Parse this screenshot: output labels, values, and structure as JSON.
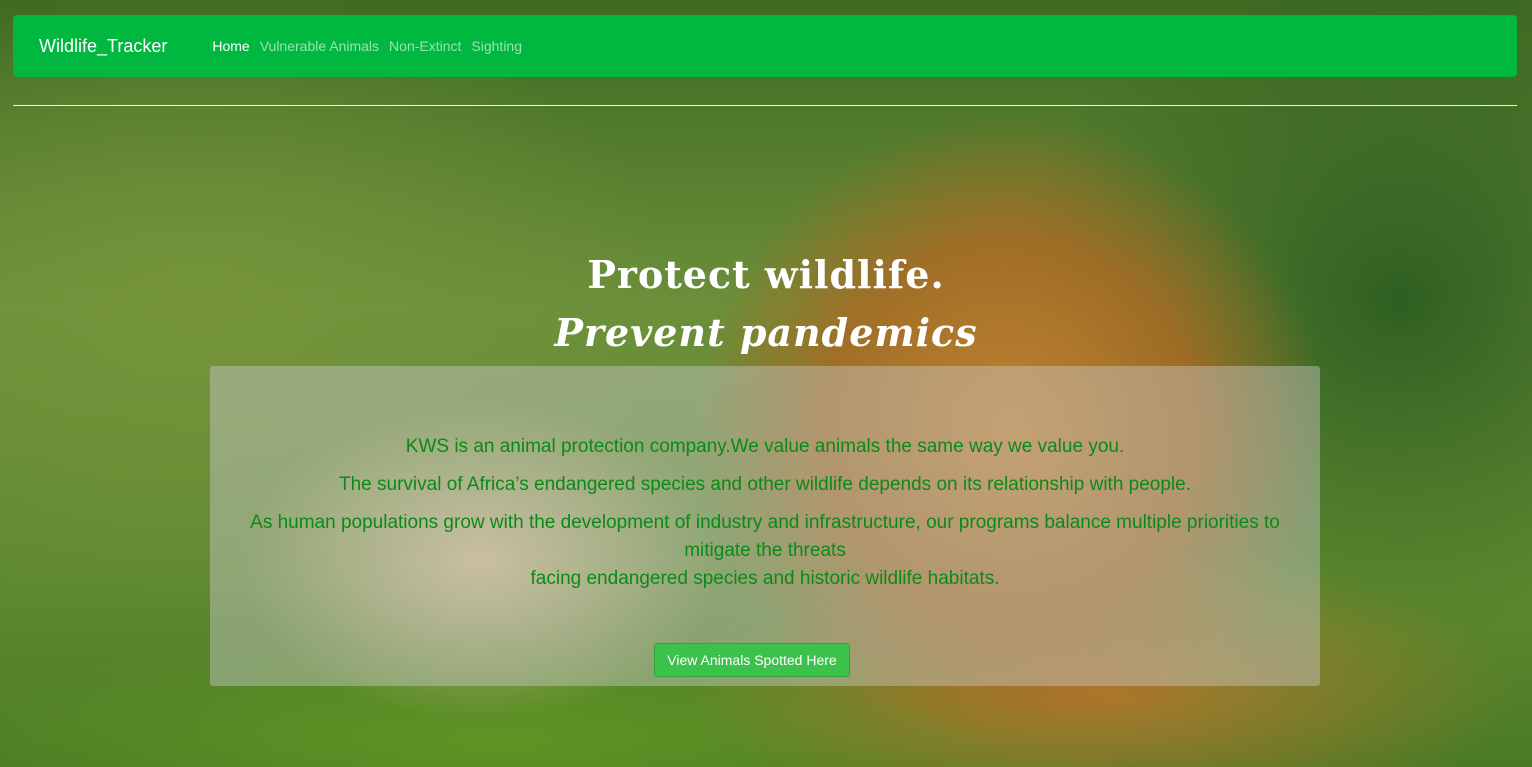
{
  "navbar": {
    "brand": "Wildlife_Tracker",
    "links": [
      "Home",
      "Vulnerable Animals",
      "Non-Extinct",
      "Sighting"
    ],
    "active": "Home",
    "color": "#00b83f"
  },
  "hero": {
    "line1": "Protect wildlife.",
    "line2": "Prevent pandemics"
  },
  "panel": {
    "paragraph1": "KWS is an animal protection company.We value animals the same way we value you.",
    "paragraph2": "The survival of Africa’s endangered species and other wildlife depends on its relationship with people.",
    "paragraph3_line1": "As human populations grow with the development of industry and infrastructure, our programs balance multiple priorities to mitigate the threats",
    "paragraph3_line2": "facing endangered species and historic wildlife habitats.",
    "text_color": "#0b8a1a",
    "button_label": "View Animals Spotted Here"
  },
  "background": {
    "icon": "lion-photo"
  }
}
